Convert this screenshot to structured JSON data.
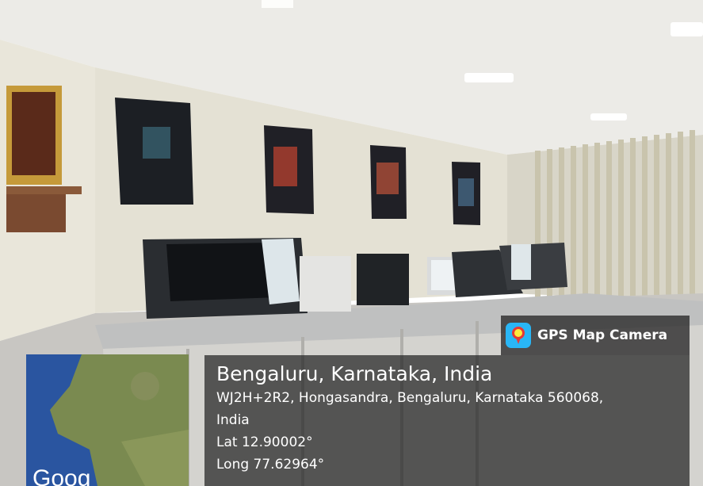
{
  "overlay": {
    "app_badge": {
      "icon": "map-pin-icon",
      "label": "GPS Map Camera",
      "icon_color": "#29b6f6"
    },
    "location": {
      "title": "Bengaluru, Karnataka, India",
      "address_line1": "WJ2H+2R2, Hongasandra, Bengaluru, Karnataka 560068,",
      "address_line2": "India",
      "lat": "Lat 12.90002°",
      "long": "Long 77.62964°"
    },
    "map_thumbnail": {
      "watermark": "Goog"
    }
  }
}
